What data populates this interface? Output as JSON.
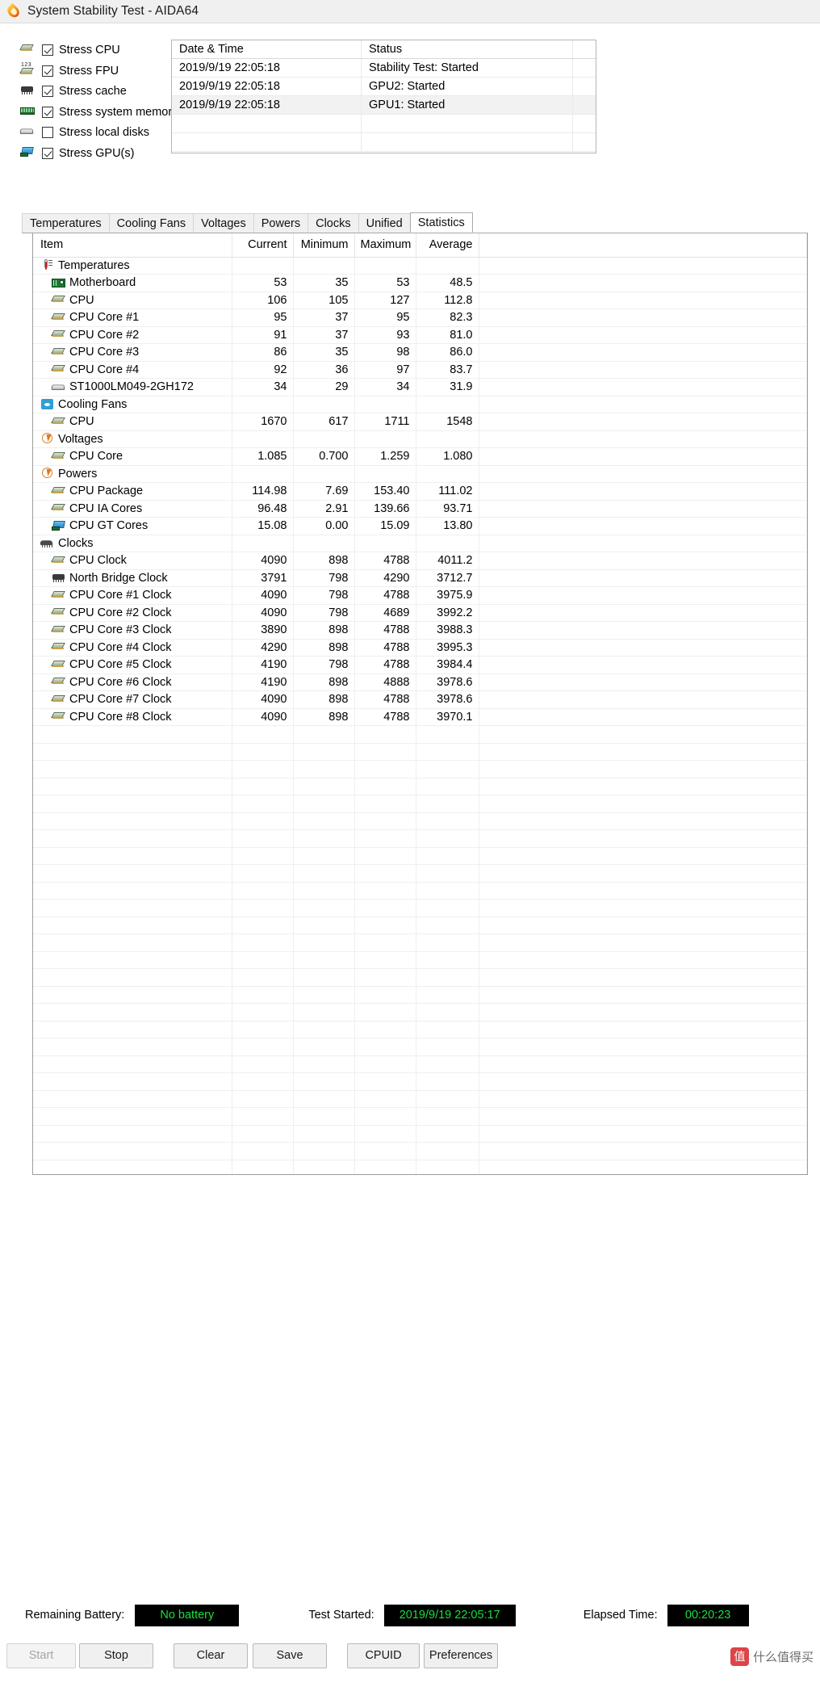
{
  "window": {
    "title": "System Stability Test - AIDA64",
    "title_icon": "flame-icon"
  },
  "stress_options": [
    {
      "label": "Stress CPU",
      "checked": true,
      "icon": "cpu-icon"
    },
    {
      "label": "Stress FPU",
      "checked": true,
      "icon": "fpu-icon"
    },
    {
      "label": "Stress cache",
      "checked": true,
      "icon": "cache-icon"
    },
    {
      "label": "Stress system memory",
      "checked": true,
      "icon": "memory-icon"
    },
    {
      "label": "Stress local disks",
      "checked": false,
      "icon": "disk-icon"
    },
    {
      "label": "Stress GPU(s)",
      "checked": true,
      "icon": "gpu-icon"
    }
  ],
  "log": {
    "headers": [
      "Date & Time",
      "Status"
    ],
    "rows": [
      {
        "datetime": "2019/9/19 22:05:18",
        "status": "Stability Test: Started"
      },
      {
        "datetime": "2019/9/19 22:05:18",
        "status": "GPU2: Started"
      },
      {
        "datetime": "2019/9/19 22:05:18",
        "status": "GPU1: Started"
      },
      {
        "datetime": "",
        "status": ""
      },
      {
        "datetime": "",
        "status": ""
      }
    ]
  },
  "tabs": [
    {
      "label": "Temperatures",
      "active": false
    },
    {
      "label": "Cooling Fans",
      "active": false
    },
    {
      "label": "Voltages",
      "active": false
    },
    {
      "label": "Powers",
      "active": false
    },
    {
      "label": "Clocks",
      "active": false
    },
    {
      "label": "Unified",
      "active": false
    },
    {
      "label": "Statistics",
      "active": true
    }
  ],
  "statistics": {
    "headers": [
      "Item",
      "Current",
      "Minimum",
      "Maximum",
      "Average"
    ],
    "rows": [
      {
        "kind": "group",
        "icon": "thermometer-icon",
        "item": "Temperatures",
        "current": "",
        "minimum": "",
        "maximum": "",
        "average": ""
      },
      {
        "kind": "item",
        "icon": "motherboard-icon",
        "item": "Motherboard",
        "current": "53",
        "minimum": "35",
        "maximum": "53",
        "average": "48.5"
      },
      {
        "kind": "item",
        "icon": "cpu-icon",
        "item": "CPU",
        "current": "106",
        "minimum": "105",
        "maximum": "127",
        "average": "112.8"
      },
      {
        "kind": "item",
        "icon": "cpu-icon",
        "item": "CPU Core #1",
        "current": "95",
        "minimum": "37",
        "maximum": "95",
        "average": "82.3"
      },
      {
        "kind": "item",
        "icon": "cpu-icon",
        "item": "CPU Core #2",
        "current": "91",
        "minimum": "37",
        "maximum": "93",
        "average": "81.0"
      },
      {
        "kind": "item",
        "icon": "cpu-icon",
        "item": "CPU Core #3",
        "current": "86",
        "minimum": "35",
        "maximum": "98",
        "average": "86.0"
      },
      {
        "kind": "item",
        "icon": "cpu-icon",
        "item": "CPU Core #4",
        "current": "92",
        "minimum": "36",
        "maximum": "97",
        "average": "83.7"
      },
      {
        "kind": "item",
        "icon": "disk-icon",
        "item": "ST1000LM049-2GH172",
        "current": "34",
        "minimum": "29",
        "maximum": "34",
        "average": "31.9"
      },
      {
        "kind": "group",
        "icon": "fan-icon",
        "item": "Cooling Fans",
        "current": "",
        "minimum": "",
        "maximum": "",
        "average": ""
      },
      {
        "kind": "item",
        "icon": "cpu-icon",
        "item": "CPU",
        "current": "1670",
        "minimum": "617",
        "maximum": "1711",
        "average": "1548"
      },
      {
        "kind": "group",
        "icon": "voltage-icon",
        "item": "Voltages",
        "current": "",
        "minimum": "",
        "maximum": "",
        "average": ""
      },
      {
        "kind": "item",
        "icon": "cpu-icon",
        "item": "CPU Core",
        "current": "1.085",
        "minimum": "0.700",
        "maximum": "1.259",
        "average": "1.080"
      },
      {
        "kind": "group",
        "icon": "voltage-icon",
        "item": "Powers",
        "current": "",
        "minimum": "",
        "maximum": "",
        "average": ""
      },
      {
        "kind": "item",
        "icon": "cpu-icon",
        "item": "CPU Package",
        "current": "114.98",
        "minimum": "7.69",
        "maximum": "153.40",
        "average": "111.02"
      },
      {
        "kind": "item",
        "icon": "cpu-icon",
        "item": "CPU IA Cores",
        "current": "96.48",
        "minimum": "2.91",
        "maximum": "139.66",
        "average": "93.71"
      },
      {
        "kind": "item",
        "icon": "gpu-icon",
        "item": "CPU GT Cores",
        "current": "15.08",
        "minimum": "0.00",
        "maximum": "15.09",
        "average": "13.80"
      },
      {
        "kind": "group",
        "icon": "clock-icon",
        "item": "Clocks",
        "current": "",
        "minimum": "",
        "maximum": "",
        "average": ""
      },
      {
        "kind": "item",
        "icon": "cpu-icon",
        "item": "CPU Clock",
        "current": "4090",
        "minimum": "898",
        "maximum": "4788",
        "average": "4011.2"
      },
      {
        "kind": "item",
        "icon": "cache-icon",
        "item": "North Bridge Clock",
        "current": "3791",
        "minimum": "798",
        "maximum": "4290",
        "average": "3712.7"
      },
      {
        "kind": "item",
        "icon": "cpu-icon",
        "item": "CPU Core #1 Clock",
        "current": "4090",
        "minimum": "798",
        "maximum": "4788",
        "average": "3975.9"
      },
      {
        "kind": "item",
        "icon": "cpu-icon",
        "item": "CPU Core #2 Clock",
        "current": "4090",
        "minimum": "798",
        "maximum": "4689",
        "average": "3992.2"
      },
      {
        "kind": "item",
        "icon": "cpu-icon",
        "item": "CPU Core #3 Clock",
        "current": "3890",
        "minimum": "898",
        "maximum": "4788",
        "average": "3988.3"
      },
      {
        "kind": "item",
        "icon": "cpu-icon",
        "item": "CPU Core #4 Clock",
        "current": "4290",
        "minimum": "898",
        "maximum": "4788",
        "average": "3995.3"
      },
      {
        "kind": "item",
        "icon": "cpu-icon",
        "item": "CPU Core #5 Clock",
        "current": "4190",
        "minimum": "798",
        "maximum": "4788",
        "average": "3984.4"
      },
      {
        "kind": "item",
        "icon": "cpu-icon",
        "item": "CPU Core #6 Clock",
        "current": "4190",
        "minimum": "898",
        "maximum": "4888",
        "average": "3978.6"
      },
      {
        "kind": "item",
        "icon": "cpu-icon",
        "item": "CPU Core #7 Clock",
        "current": "4090",
        "minimum": "898",
        "maximum": "4788",
        "average": "3978.6"
      },
      {
        "kind": "item",
        "icon": "cpu-icon",
        "item": "CPU Core #8 Clock",
        "current": "4090",
        "minimum": "898",
        "maximum": "4788",
        "average": "3970.1"
      }
    ],
    "empty_row_count": 29
  },
  "status_strip": {
    "battery_label": "Remaining Battery:",
    "battery_value": "No battery",
    "started_label": "Test Started:",
    "started_value": "2019/9/19 22:05:17",
    "elapsed_label": "Elapsed Time:",
    "elapsed_value": "00:20:23",
    "value_color": "#19e03c",
    "value_bg": "#000000"
  },
  "buttons": [
    {
      "label": "Start",
      "disabled": true
    },
    {
      "label": "Stop",
      "disabled": false
    },
    {
      "label": "Clear",
      "disabled": false
    },
    {
      "label": "Save",
      "disabled": false
    },
    {
      "label": "CPUID",
      "disabled": false
    },
    {
      "label": "Preferences",
      "disabled": false
    }
  ],
  "watermark": {
    "badge": "值",
    "text": "什么值得买"
  }
}
